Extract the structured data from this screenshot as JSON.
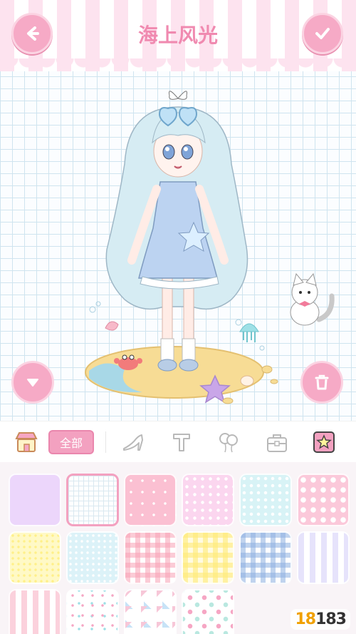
{
  "header": {
    "title": "海上风光",
    "back_icon": "arrow-left-icon",
    "confirm_icon": "check-icon"
  },
  "stage": {
    "background": "grid-paper",
    "down_icon": "triangle-down-icon",
    "delete_icon": "trash-icon"
  },
  "toolbar": {
    "shop_icon": "shop-icon",
    "all_label": "全部",
    "items": [
      {
        "icon": "high-heel-icon"
      },
      {
        "icon": "text-t-icon"
      },
      {
        "icon": "balloon-icon"
      },
      {
        "icon": "bag-icon"
      },
      {
        "icon": "star-icon"
      }
    ]
  },
  "patterns": [
    {
      "name": "lavender-solid"
    },
    {
      "name": "white-grid",
      "selected": true
    },
    {
      "name": "pink-stars"
    },
    {
      "name": "pink-polka"
    },
    {
      "name": "mint-polka"
    },
    {
      "name": "pink-big-polka"
    },
    {
      "name": "yellow-dots"
    },
    {
      "name": "blue-dots"
    },
    {
      "name": "pink-gingham"
    },
    {
      "name": "yellow-gingham"
    },
    {
      "name": "blue-gingham"
    },
    {
      "name": "lavender-stripes"
    },
    {
      "name": "pink-stripes"
    },
    {
      "name": "confetti"
    },
    {
      "name": "triangles"
    },
    {
      "name": "pastel-dots"
    }
  ],
  "watermark": {
    "text_a": "18",
    "text_b": "183"
  },
  "colors": {
    "accent": "#f3a1c0",
    "grid": "#cfe4ef"
  }
}
